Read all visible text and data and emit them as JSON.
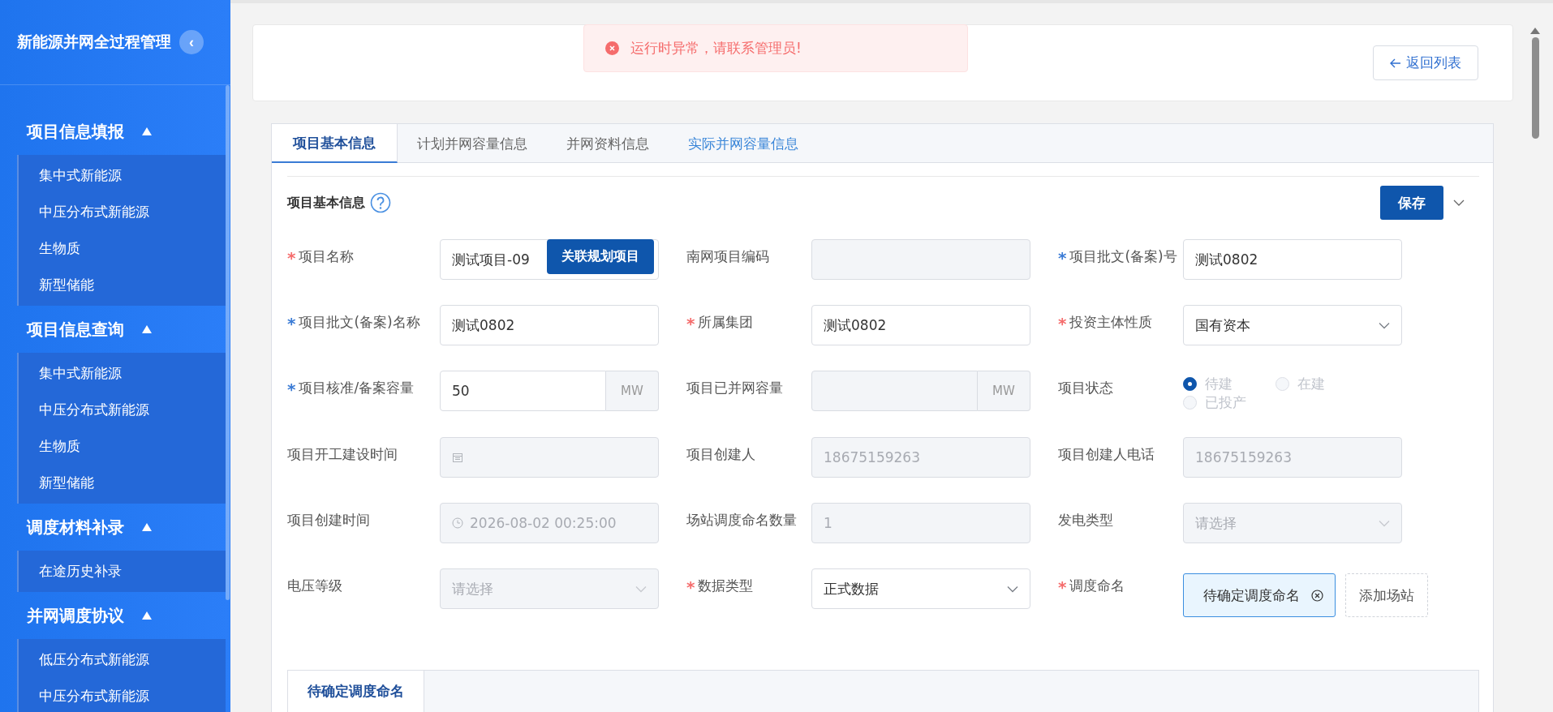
{
  "sidebar": {
    "title": "新能源并网全过程管理",
    "collapse_button": "‹",
    "groups": [
      {
        "title": "项目信息填报",
        "expanded": true,
        "items": [
          {
            "label": "集中式新能源",
            "selected": false
          },
          {
            "label": "中压分布式新能源",
            "selected": false
          },
          {
            "label": "生物质",
            "selected": false
          },
          {
            "label": "新型储能",
            "selected": false
          }
        ]
      },
      {
        "title": "项目信息查询",
        "expanded": true,
        "items": [
          {
            "label": "集中式新能源",
            "selected": false
          },
          {
            "label": "中压分布式新能源",
            "selected": false
          },
          {
            "label": "生物质",
            "selected": false
          },
          {
            "label": "新型储能",
            "selected": false
          }
        ]
      },
      {
        "title": "调度材料补录",
        "expanded": true,
        "items": [
          {
            "label": "在途历史补录",
            "selected": false
          }
        ]
      },
      {
        "title": "并网调度协议",
        "expanded": true,
        "items": [
          {
            "label": "低压分布式新能源",
            "selected": false
          },
          {
            "label": "中压分布式新能源",
            "selected": false
          }
        ]
      }
    ]
  },
  "toast": {
    "kind": "error",
    "message": "运行时异常，请联系管理员!"
  },
  "header": {
    "back_button": "返回列表"
  },
  "tabs": [
    {
      "label": "项目基本信息",
      "selected": true,
      "highlighted": false
    },
    {
      "label": "计划并网容量信息",
      "selected": false,
      "highlighted": false
    },
    {
      "label": "并网资料信息",
      "selected": false,
      "highlighted": false
    },
    {
      "label": "实际并网容量信息",
      "selected": false,
      "highlighted": true
    }
  ],
  "section": {
    "title": "项目基本信息",
    "save_button": "保存"
  },
  "fields": [
    {
      "label": "项目名称",
      "required": {
        "mark": "*",
        "color": "#f56c6c"
      },
      "kind": "text",
      "value": "测试项目-09",
      "button": "关联规划项目",
      "disabled": false
    },
    {
      "label": "南网项目编码",
      "kind": "text",
      "disabled": true
    },
    {
      "label": "项目批文(备案)号",
      "required": {
        "mark": "*",
        "color": "#3a7bd5"
      },
      "kind": "text",
      "value": "测试0802",
      "disabled": false
    },
    {
      "label": "项目批文(备案)名称",
      "required": {
        "mark": "*",
        "color": "#3a7bd5"
      },
      "kind": "text",
      "value": "测试0802",
      "disabled": false
    },
    {
      "label": "所属集团",
      "required": {
        "mark": "*",
        "color": "#f56c6c"
      },
      "kind": "text",
      "value": "测试0802",
      "disabled": false
    },
    {
      "label": "投资主体性质",
      "required": {
        "mark": "*",
        "color": "#f56c6c"
      },
      "kind": "select",
      "value": "国有资本",
      "disabled": false
    },
    {
      "label": "项目核准/备案容量",
      "required": {
        "mark": "*",
        "color": "#3a7bd5"
      },
      "kind": "unit",
      "value": "50",
      "unit": "MW",
      "disabled": false
    },
    {
      "label": "项目已并网容量",
      "kind": "unit",
      "unit": "MW",
      "disabled": true
    },
    {
      "label": "项目状态",
      "kind": "radio",
      "disabled": true,
      "options": [
        {
          "label": "待建",
          "selected": true
        },
        {
          "label": "在建",
          "selected": false
        },
        {
          "label": "已投产",
          "selected": false
        }
      ]
    },
    {
      "label": "项目开工建设时间",
      "kind": "date",
      "disabled": true
    },
    {
      "label": "项目创建人",
      "kind": "text",
      "value": "18675159263",
      "disabled": true
    },
    {
      "label": "项目创建人电话",
      "kind": "text",
      "value": "18675159263",
      "disabled": true
    },
    {
      "label": "项目创建时间",
      "kind": "datetime",
      "value": "2026-08-02 00:25:00",
      "disabled": true
    },
    {
      "label": "场站调度命名数量",
      "kind": "text",
      "value": "1",
      "disabled": true
    },
    {
      "label": "发电类型",
      "kind": "select",
      "placeholder": "请选择",
      "disabled": true
    },
    {
      "label": "电压等级",
      "kind": "select",
      "placeholder": "请选择",
      "disabled": true
    },
    {
      "label": "数据类型",
      "required": {
        "mark": "*",
        "color": "#f56c6c"
      },
      "kind": "select",
      "value": "正式数据",
      "disabled": false
    },
    {
      "label": "调度命名",
      "required": {
        "mark": "*",
        "color": "#f56c6c"
      },
      "kind": "tags",
      "tags": [
        {
          "label": "待确定调度命名"
        }
      ],
      "add_button": "添加场站"
    }
  ],
  "sub_tabs": [
    {
      "label": "待确定调度命名",
      "selected": true
    }
  ]
}
